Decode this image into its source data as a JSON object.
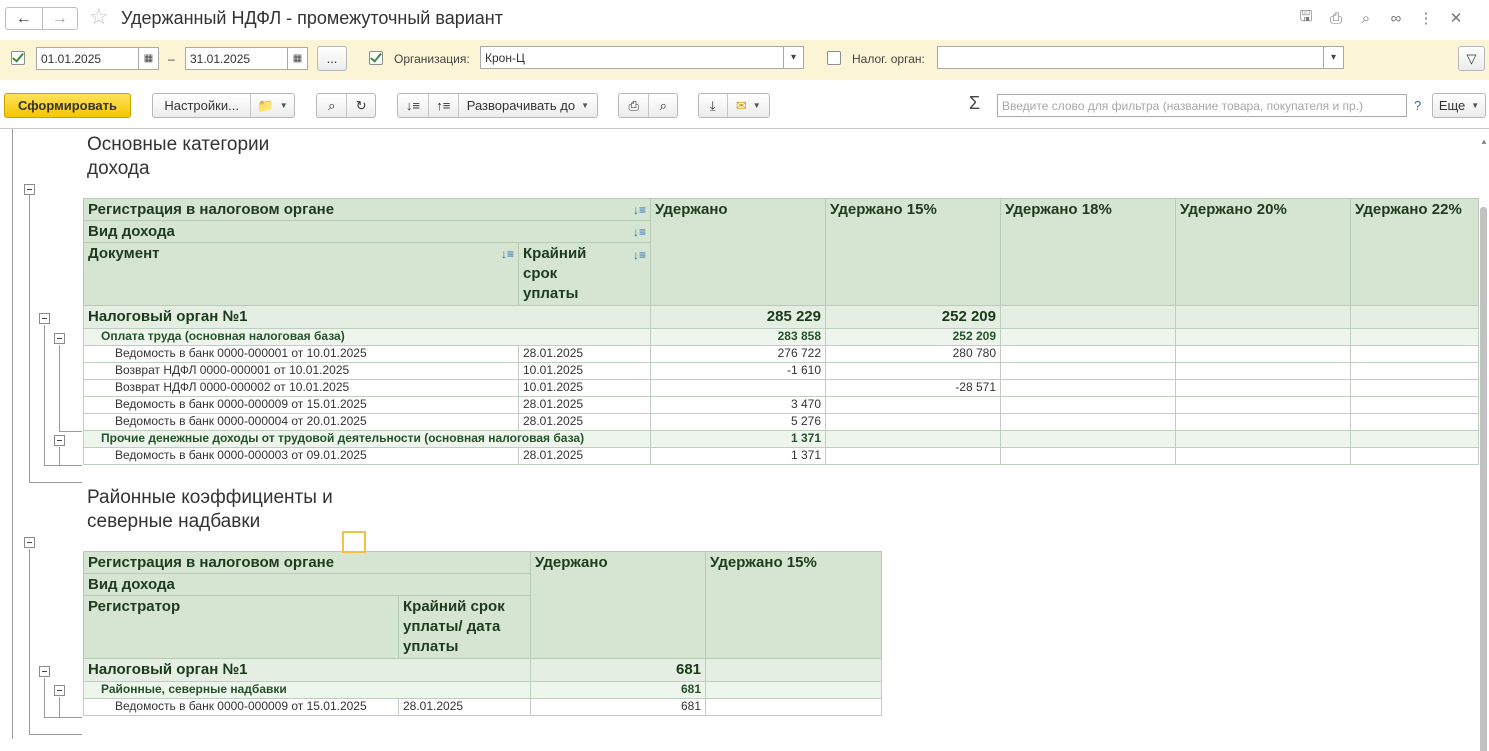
{
  "window": {
    "title": "Удержанный НДФЛ - промежуточный вариант",
    "icons": [
      "save-icon",
      "print-icon",
      "preview-icon",
      "link-icon",
      "more-vert-icon",
      "close-icon"
    ]
  },
  "filters": {
    "period_checked": true,
    "date_from": "01.01.2025",
    "dash": "–",
    "date_to": "31.01.2025",
    "ellipsis": "...",
    "org_checked": true,
    "org_label": "Организация:",
    "org_value": "Крон-Ц",
    "tax_checked": false,
    "tax_label": "Налог. орган:",
    "tax_value": ""
  },
  "toolbar": {
    "generate": "Сформировать",
    "settings": "Настройки...",
    "expand": "Разворачивать до",
    "search_placeholder": "Введите слово для фильтра (название товара, покупателя и пр.)",
    "help": "?",
    "more": "Еще",
    "sigma": "Σ"
  },
  "report": {
    "section1": {
      "title_line1": "Основные категории",
      "title_line2": "дохода",
      "headers": {
        "reg": "Регистрация в налоговом органе",
        "income": "Вид дохода",
        "doc": "Документ",
        "deadline": "Крайний срок уплаты",
        "withheld": "Удержано",
        "w15": "Удержано 15%",
        "w18": "Удержано 18%",
        "w20": "Удержано 20%",
        "w22": "Удержано 22%"
      },
      "group": {
        "name": "Налоговый орган №1",
        "withheld": "285 229",
        "w15": "252 209"
      },
      "subgroups": [
        {
          "name": "Оплата труда (основная налоговая база)",
          "withheld": "283 858",
          "w15": "252 209",
          "rows": [
            {
              "doc": "Ведомость в банк 0000-000001 от 10.01.2025",
              "date": "28.01.2025",
              "withheld": "276 722",
              "w15": "280 780"
            },
            {
              "doc": "Возврат НДФЛ 0000-000001 от 10.01.2025",
              "date": "10.01.2025",
              "withheld": "-1 610",
              "w15": ""
            },
            {
              "doc": "Возврат НДФЛ 0000-000002 от 10.01.2025",
              "date": "10.01.2025",
              "withheld": "",
              "w15": "-28 571"
            },
            {
              "doc": "Ведомость в банк 0000-000009 от 15.01.2025",
              "date": "28.01.2025",
              "withheld": "3 470",
              "w15": ""
            },
            {
              "doc": "Ведомость в банк 0000-000004 от 20.01.2025",
              "date": "28.01.2025",
              "withheld": "5 276",
              "w15": ""
            }
          ]
        },
        {
          "name": "Прочие денежные доходы от трудовой деятельности (основная налоговая база)",
          "withheld": "1 371",
          "w15": "",
          "rows": [
            {
              "doc": "Ведомость в банк 0000-000003 от 09.01.2025",
              "date": "28.01.2025",
              "withheld": "1 371",
              "w15": ""
            }
          ]
        }
      ]
    },
    "section2": {
      "title_line1": "Районные коэффициенты и",
      "title_line2": "северные надбавки",
      "headers": {
        "reg": "Регистрация в налоговом органе",
        "income": "Вид дохода",
        "registrar": "Регистратор",
        "deadline": "Крайний срок уплаты/ дата уплаты",
        "withheld": "Удержано",
        "w15": "Удержано 15%"
      },
      "group": {
        "name": "Налоговый орган №1",
        "withheld": "681",
        "w15": ""
      },
      "subgroup": {
        "name": "Районные, северные надбавки",
        "withheld": "681",
        "w15": ""
      },
      "row": {
        "doc": "Ведомость в банк 0000-000009 от 15.01.2025",
        "date": "28.01.2025",
        "withheld": "681",
        "w15": ""
      }
    }
  }
}
